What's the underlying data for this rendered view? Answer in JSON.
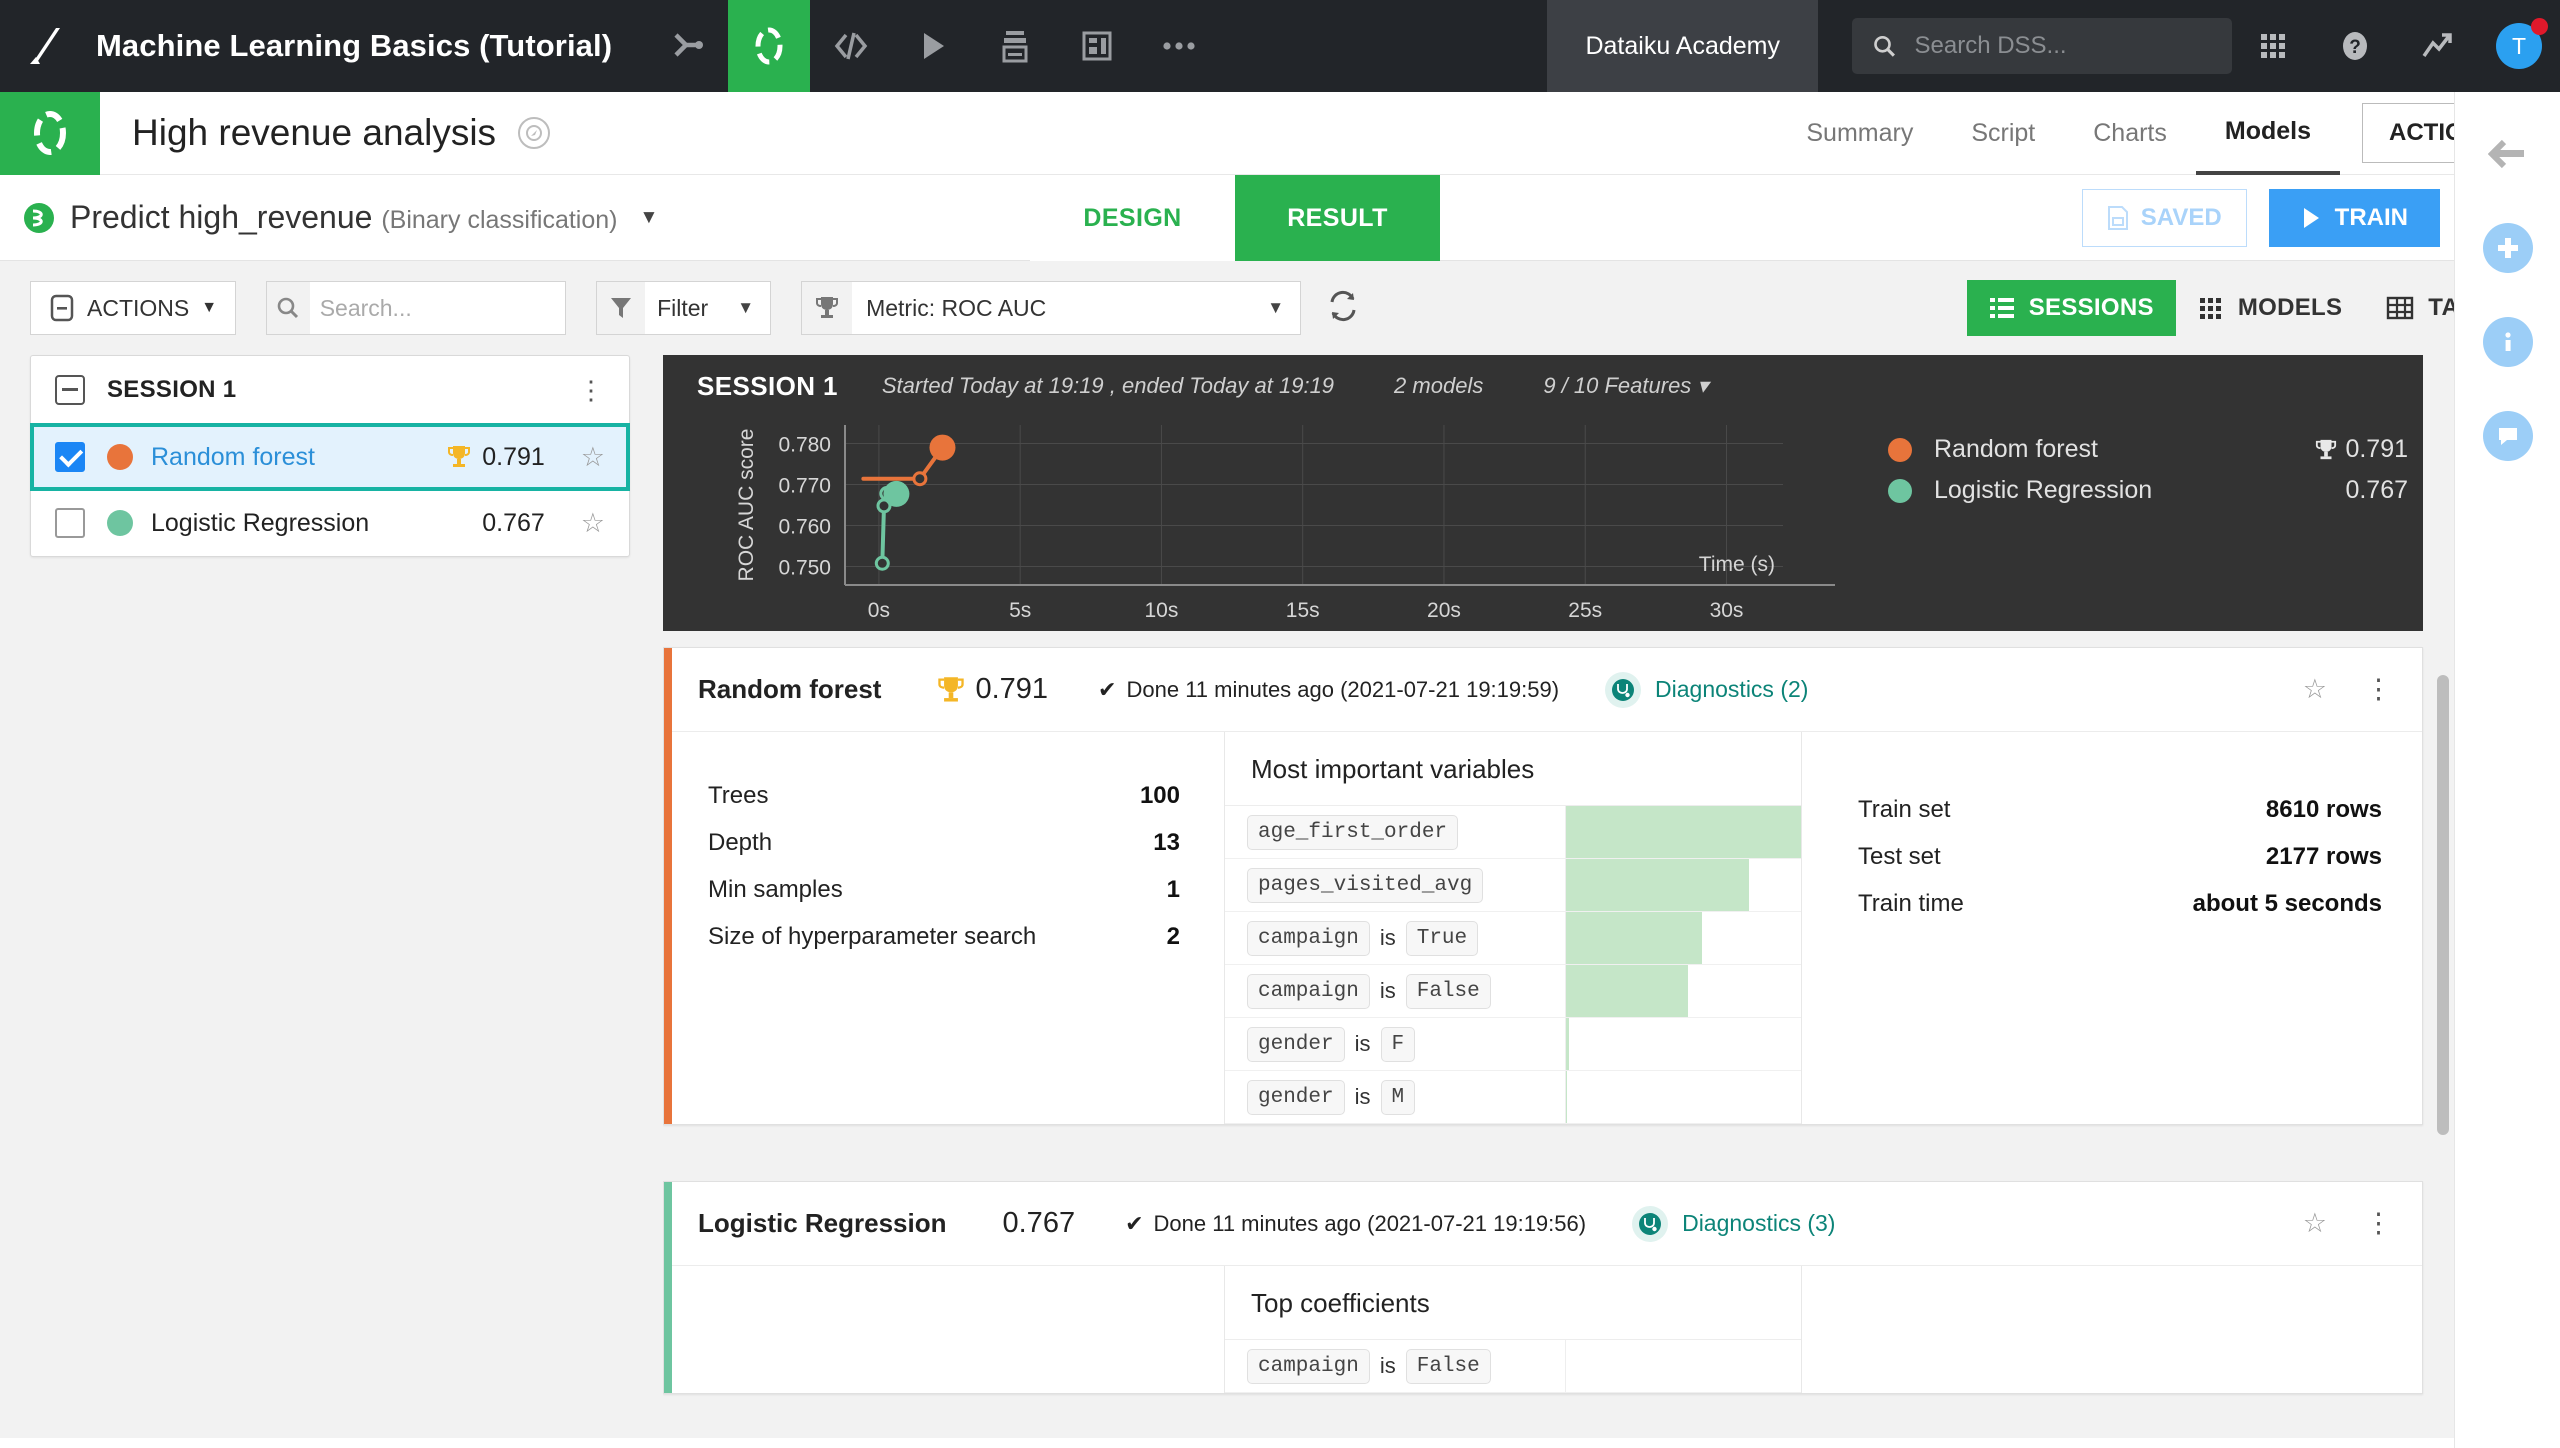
{
  "topbar": {
    "logo_icon": "dataiku-logo-icon",
    "project_name": "Machine Learning Basics (Tutorial)",
    "nav_icons": [
      {
        "name": "flow-icon",
        "active": false
      },
      {
        "name": "lab-icon",
        "active": true
      },
      {
        "name": "code-icon",
        "active": false
      },
      {
        "name": "jobs-icon",
        "active": false
      },
      {
        "name": "dataset-icon",
        "active": false
      },
      {
        "name": "dashboard-icon",
        "active": false
      },
      {
        "name": "more-icon",
        "active": false
      }
    ],
    "academy_label": "Dataiku Academy",
    "search_placeholder": "Search DSS...",
    "search_value": "",
    "apps_icon": "grid-apps-icon",
    "help_icon": "help-icon",
    "activity_icon": "trending-icon",
    "avatar_initial": "T",
    "notification_color": "#e0192b"
  },
  "header": {
    "lab_icon": "lab-green-icon",
    "title": "High revenue analysis",
    "badge_icon": "visual-analysis-icon",
    "tabs": [
      {
        "label": "Summary",
        "active": false
      },
      {
        "label": "Script",
        "active": false
      },
      {
        "label": "Charts",
        "active": false
      },
      {
        "label": "Models",
        "active": true
      }
    ],
    "actions_label": "ACTIONS"
  },
  "taskbar": {
    "model_icon": "prediction-icon",
    "title": "Predict high_revenue",
    "subtitle": "(Binary classification)",
    "segments": [
      {
        "label": "DESIGN",
        "active": false
      },
      {
        "label": "RESULT",
        "active": true
      }
    ],
    "saved_label": "SAVED",
    "train_label": "TRAIN"
  },
  "toolbar": {
    "actions_label": "ACTIONS",
    "search_placeholder": "Search...",
    "search_value": "",
    "filter_label": "Filter",
    "metric_label": "Metric: ROC AUC",
    "refresh_icon": "refresh-icon",
    "views": [
      {
        "label": "SESSIONS",
        "icon": "list-icon",
        "active": true
      },
      {
        "label": "MODELS",
        "icon": "grid-icon",
        "active": false
      },
      {
        "label": "TABLE",
        "icon": "table-icon",
        "active": false
      }
    ]
  },
  "sidebar": {
    "session_title": "SESSION 1",
    "models": [
      {
        "name": "Random forest",
        "score": "0.791",
        "color": "#e8743b",
        "checked": true,
        "selected": true,
        "trophy": true,
        "starred": false
      },
      {
        "name": "Logistic Regression",
        "score": "0.767",
        "color": "#6ec5a0",
        "checked": false,
        "selected": false,
        "trophy": false,
        "starred": false
      }
    ]
  },
  "session_chart": {
    "title": "SESSION 1",
    "meta": "Started Today at 19:19 , ended Today at 19:19",
    "models_count": "2 models",
    "features": "9 / 10 Features",
    "legend": [
      {
        "label": "Random forest",
        "value": "0.791",
        "color": "#e8743b",
        "trophy": true
      },
      {
        "label": "Logistic Regression",
        "value": "0.767",
        "color": "#6ec5a0",
        "trophy": false
      }
    ]
  },
  "chart_data": {
    "type": "line",
    "title": "SESSION 1",
    "xlabel": "Time (s)",
    "ylabel": "ROC AUC score",
    "xlim": [
      -1.2,
      32
    ],
    "ylim": [
      0.7455,
      0.7845
    ],
    "xticks": [
      0,
      5,
      10,
      15,
      20,
      25,
      30
    ],
    "xticklabels": [
      "0s",
      "5s",
      "10s",
      "15s",
      "20s",
      "25s",
      "30s"
    ],
    "yticks": [
      0.75,
      0.76,
      0.77,
      0.78
    ],
    "yticklabels": [
      "0.750",
      "0.760",
      "0.770",
      "0.780"
    ],
    "grid": true,
    "background": "#333333",
    "legend_position": "right",
    "series": [
      {
        "name": "Random forest",
        "color": "#e8743b",
        "points": [
          {
            "x": -0.55,
            "y": 0.7714,
            "marker": "none"
          },
          {
            "x": 1.45,
            "y": 0.7714,
            "marker": "open"
          },
          {
            "x": 2.25,
            "y": 0.779,
            "marker": "filled-large"
          }
        ]
      },
      {
        "name": "Logistic Regression",
        "color": "#6ec5a0",
        "points": [
          {
            "x": 0.12,
            "y": 0.7508,
            "marker": "open"
          },
          {
            "x": 0.18,
            "y": 0.7648,
            "marker": "open"
          },
          {
            "x": 0.28,
            "y": 0.7678,
            "marker": "open"
          },
          {
            "x": 0.62,
            "y": 0.7677,
            "marker": "filled-large"
          }
        ]
      }
    ]
  },
  "model_cards": [
    {
      "name": "Random forest",
      "score": "0.791",
      "trophy": true,
      "status": "Done 11 minutes ago (2021-07-21 19:19:59)",
      "diagnostics": "Diagnostics (2)",
      "accent_color": "#e8743b",
      "stats_left": [
        {
          "label": "Trees",
          "value": "100"
        },
        {
          "label": "Depth",
          "value": "13"
        },
        {
          "label": "Min samples",
          "value": "1"
        },
        {
          "label": "Size of hyperparameter search",
          "value": "2"
        }
      ],
      "variables_title": "Most important variables",
      "variables": [
        {
          "feature": "age_first_order",
          "operator": "",
          "value": "",
          "bar_pct": 100
        },
        {
          "feature": "pages_visited_avg",
          "operator": "",
          "value": "",
          "bar_pct": 78
        },
        {
          "feature": "campaign",
          "operator": "is",
          "value": "True",
          "bar_pct": 58
        },
        {
          "feature": "campaign",
          "operator": "is",
          "value": "False",
          "bar_pct": 52
        },
        {
          "feature": "gender",
          "operator": "is",
          "value": "F",
          "bar_pct": 1.2
        },
        {
          "feature": "gender",
          "operator": "is",
          "value": "M",
          "bar_pct": 0.6
        }
      ],
      "stats_right": [
        {
          "label": "Train set",
          "value": "8610 rows"
        },
        {
          "label": "Test set",
          "value": "2177 rows"
        },
        {
          "label": "Train time",
          "value": "about 5 seconds"
        }
      ]
    },
    {
      "name": "Logistic Regression",
      "score": "0.767",
      "trophy": false,
      "status": "Done 11 minutes ago (2021-07-21 19:19:56)",
      "diagnostics": "Diagnostics (3)",
      "accent_color": "#6ec5a0",
      "stats_left": [],
      "variables_title": "Top coefficients",
      "variables": [],
      "stats_right": []
    }
  ],
  "rail": {
    "icons": [
      {
        "name": "back-arrow-icon",
        "style": "gray"
      },
      {
        "name": "add-icon",
        "style": "blue"
      },
      {
        "name": "info-icon",
        "style": "blue"
      },
      {
        "name": "comment-icon",
        "style": "blue"
      }
    ]
  }
}
